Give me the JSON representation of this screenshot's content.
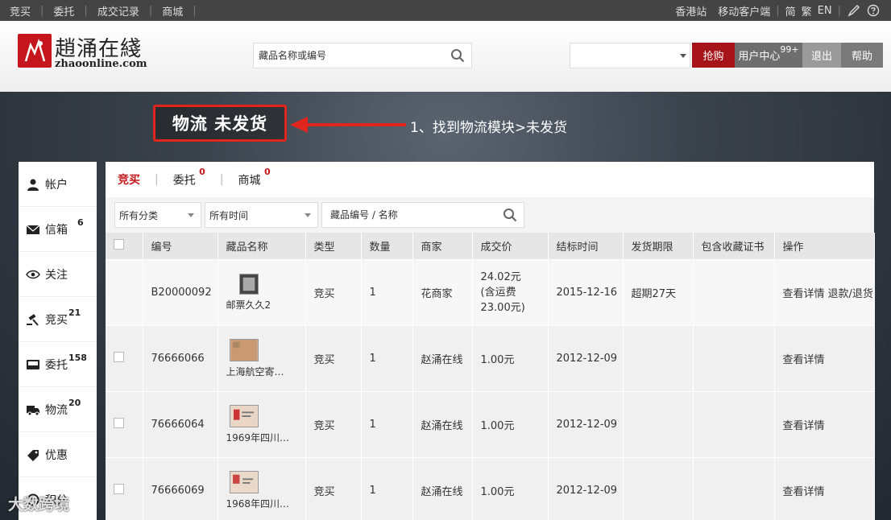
{
  "topbar": {
    "left_items": [
      "竞买",
      "委托",
      "成交记录",
      "商城"
    ],
    "right_items": [
      "香港站",
      "移动客户端",
      "简",
      "繁",
      "EN"
    ],
    "icons": [
      "pencil-icon",
      "help-icon"
    ]
  },
  "header": {
    "logo_cn": "趙涌在綫",
    "logo_en": "zhaoonline.com",
    "search_placeholder": "藏品名称或编号",
    "select_value": "",
    "buttons": {
      "qiang": "抢购",
      "user_center": "用户中心",
      "user_badge": "99+",
      "logout": "退出",
      "help": "帮助"
    },
    "colors": {
      "qiang": "#a6141a",
      "user_center": "#6e6e6e",
      "logout": "#9a9a9a",
      "help": "#7a7a7a"
    }
  },
  "annotation": {
    "box_text": "物流 未发货",
    "step_text": "1、找到物流模块>未发货"
  },
  "sidebar": {
    "items": [
      {
        "label": "帐户",
        "icon": "user-icon",
        "badge": ""
      },
      {
        "label": "信箱",
        "icon": "mail-icon",
        "badge": "6"
      },
      {
        "label": "关注",
        "icon": "eye-icon",
        "badge": ""
      },
      {
        "label": "竞买",
        "icon": "gavel-icon",
        "badge": "21"
      },
      {
        "label": "委托",
        "icon": "tray-icon",
        "badge": "158"
      },
      {
        "label": "物流",
        "icon": "truck-icon",
        "badge": "20"
      },
      {
        "label": "优惠",
        "icon": "tag-icon",
        "badge": ""
      },
      {
        "label": "积分",
        "icon": "points-icon",
        "badge": ""
      }
    ]
  },
  "tabs": [
    {
      "label": "竞买",
      "badge": ""
    },
    {
      "label": "委托",
      "badge": "0"
    },
    {
      "label": "商城",
      "badge": "0"
    }
  ],
  "filters": {
    "category": "所有分类",
    "time": "所有时间",
    "search_placeholder": "藏品编号 / 名称"
  },
  "table": {
    "headers": [
      "编号",
      "藏品名称",
      "类型",
      "数量",
      "商家",
      "成交价",
      "结标时间",
      "发货期限",
      "包含收藏证书",
      "操作"
    ],
    "rows": [
      {
        "id": "B20000092",
        "name": "邮票久久2",
        "type": "竞买",
        "qty": "1",
        "seller": "花商家",
        "price_lines": [
          "24.02元",
          "(含运费",
          "23.00元)"
        ],
        "end_time": "2015-12-16",
        "deadline": "超期27天",
        "cert": "",
        "actions": [
          "查看详情",
          "退款/退货"
        ],
        "has_checkbox": false
      },
      {
        "id": "76666066",
        "name": "上海航空寄…",
        "type": "竞买",
        "qty": "1",
        "seller": "赵涌在线",
        "price_lines": [
          "1.00元"
        ],
        "end_time": "2012-12-09",
        "deadline": "",
        "cert": "",
        "actions": [
          "查看详情"
        ],
        "has_checkbox": true
      },
      {
        "id": "76666064",
        "name": "1969年四川…",
        "type": "竞买",
        "qty": "1",
        "seller": "赵涌在线",
        "price_lines": [
          "1.00元"
        ],
        "end_time": "2012-12-09",
        "deadline": "",
        "cert": "",
        "actions": [
          "查看详情"
        ],
        "has_checkbox": true
      },
      {
        "id": "76666069",
        "name": "1968年四川…",
        "type": "竞买",
        "qty": "1",
        "seller": "赵涌在线",
        "price_lines": [
          "1.00元"
        ],
        "end_time": "2012-12-09",
        "deadline": "",
        "cert": "",
        "actions": [
          "查看详情"
        ],
        "has_checkbox": true
      }
    ]
  },
  "watermark": "大数跨境"
}
